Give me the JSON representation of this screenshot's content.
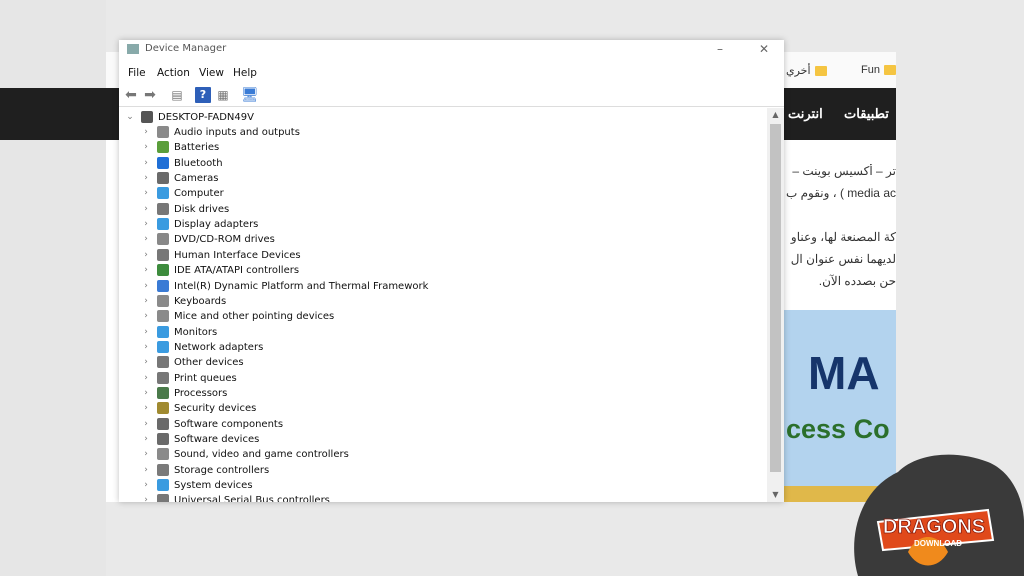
{
  "window": {
    "title": "Device Manager",
    "menu": [
      "File",
      "Action",
      "View",
      "Help"
    ],
    "root": "DESKTOP-FADN49V"
  },
  "devices": [
    {
      "label": "Audio inputs and outputs",
      "icon": "speaker-icon",
      "color": "#8a8a8a"
    },
    {
      "label": "Batteries",
      "icon": "battery-icon",
      "color": "#5a9e3a"
    },
    {
      "label": "Bluetooth",
      "icon": "bluetooth-icon",
      "color": "#1f6fd6"
    },
    {
      "label": "Cameras",
      "icon": "camera-icon",
      "color": "#6a6a6a"
    },
    {
      "label": "Computer",
      "icon": "computer-icon",
      "color": "#3a9be0"
    },
    {
      "label": "Disk drives",
      "icon": "disk-icon",
      "color": "#777777"
    },
    {
      "label": "Display adapters",
      "icon": "display-adapter-icon",
      "color": "#3a9be0"
    },
    {
      "label": "DVD/CD-ROM drives",
      "icon": "dvd-icon",
      "color": "#888888"
    },
    {
      "label": "Human Interface Devices",
      "icon": "hid-icon",
      "color": "#777777"
    },
    {
      "label": "IDE ATA/ATAPI controllers",
      "icon": "ide-controller-icon",
      "color": "#3d8c3d"
    },
    {
      "label": "Intel(R) Dynamic Platform and Thermal Framework",
      "icon": "chip-icon",
      "color": "#3a7bd5"
    },
    {
      "label": "Keyboards",
      "icon": "keyboard-icon",
      "color": "#8a8a8a"
    },
    {
      "label": "Mice and other pointing devices",
      "icon": "mouse-icon",
      "color": "#8a8a8a"
    },
    {
      "label": "Monitors",
      "icon": "monitor-icon",
      "color": "#3a9be0"
    },
    {
      "label": "Network adapters",
      "icon": "network-icon",
      "color": "#3a9be0"
    },
    {
      "label": "Other devices",
      "icon": "unknown-device-icon",
      "color": "#777777"
    },
    {
      "label": "Print queues",
      "icon": "printer-icon",
      "color": "#777777"
    },
    {
      "label": "Processors",
      "icon": "processor-icon",
      "color": "#4a7a4a"
    },
    {
      "label": "Security devices",
      "icon": "security-icon",
      "color": "#a08a30"
    },
    {
      "label": "Software components",
      "icon": "software-component-icon",
      "color": "#6a6a6a"
    },
    {
      "label": "Software devices",
      "icon": "software-device-icon",
      "color": "#6a6a6a"
    },
    {
      "label": "Sound, video and game controllers",
      "icon": "sound-icon",
      "color": "#8a8a8a"
    },
    {
      "label": "Storage controllers",
      "icon": "storage-icon",
      "color": "#7a7a7a"
    },
    {
      "label": "System devices",
      "icon": "system-device-icon",
      "color": "#3a9be0"
    },
    {
      "label": "Universal Serial Bus controllers",
      "icon": "usb-icon",
      "color": "#777777"
    }
  ],
  "background": {
    "bookmarks": [
      "Fun",
      "أخري"
    ],
    "nav": [
      "تطبيقات",
      "انترنت"
    ],
    "article": [
      "تر – أكسيس بوينت –",
      "media ac ) ، ونقوم ب",
      "كة المصنعة لها، وعناو",
      "لديهما نفس عنوان ال",
      "حن بصدده الآن."
    ],
    "banner": [
      "MA",
      "cess Co"
    ]
  },
  "logo": {
    "line1": "DRAGONS",
    "line2": "DOWNLOAD"
  }
}
